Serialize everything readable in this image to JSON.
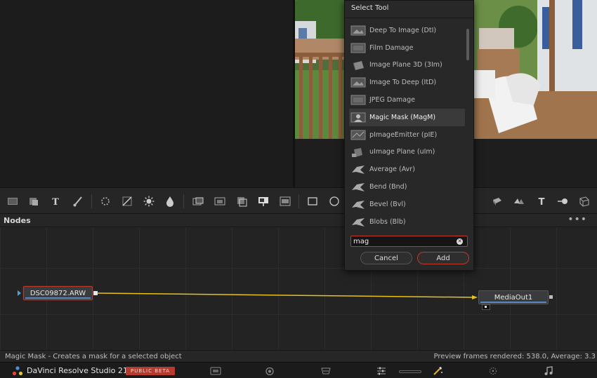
{
  "dialog": {
    "title": "Select Tool",
    "search_value": "mag",
    "cancel_label": "Cancel",
    "add_label": "Add",
    "items": [
      {
        "label": "Deep To Image (DtI)",
        "icon": "image-icon"
      },
      {
        "label": "Film Damage",
        "icon": "image-icon"
      },
      {
        "label": "Image Plane 3D (3Im)",
        "icon": "plane-3d-icon"
      },
      {
        "label": "Image To Deep (ItD)",
        "icon": "image-icon"
      },
      {
        "label": "JPEG Damage",
        "icon": "image-icon"
      },
      {
        "label": "Magic Mask (MagM)",
        "icon": "mask-icon"
      },
      {
        "label": "pImageEmitter (pIE)",
        "icon": "particle-icon"
      },
      {
        "label": "uImage Plane (uIm)",
        "icon": "plane-3d-icon"
      },
      {
        "label": "Average (Avr)",
        "icon": "warp-icon"
      },
      {
        "label": "Bend (Bnd)",
        "icon": "warp-icon"
      },
      {
        "label": "Bevel (Bvl)",
        "icon": "warp-icon"
      },
      {
        "label": "Blobs (Blb)",
        "icon": "warp-icon"
      }
    ],
    "selected_index": 5
  },
  "nodes_panel": {
    "title": "Nodes",
    "menu_label": "•••",
    "nodes": [
      {
        "label": "DSC09872.ARW"
      },
      {
        "label": "MediaOut1"
      }
    ]
  },
  "status": {
    "left": "Magic Mask - Creates a mask for a selected object",
    "right": "Preview frames rendered: 538.0,  Average: 3.3"
  },
  "app": {
    "name": "DaVinci Resolve Studio 21",
    "badge": "PUBLIC BETA"
  },
  "colors": {
    "accent_red": "#c0392b",
    "connection_yellow": "#e8c21a",
    "node_blue": "#5b87c5"
  }
}
